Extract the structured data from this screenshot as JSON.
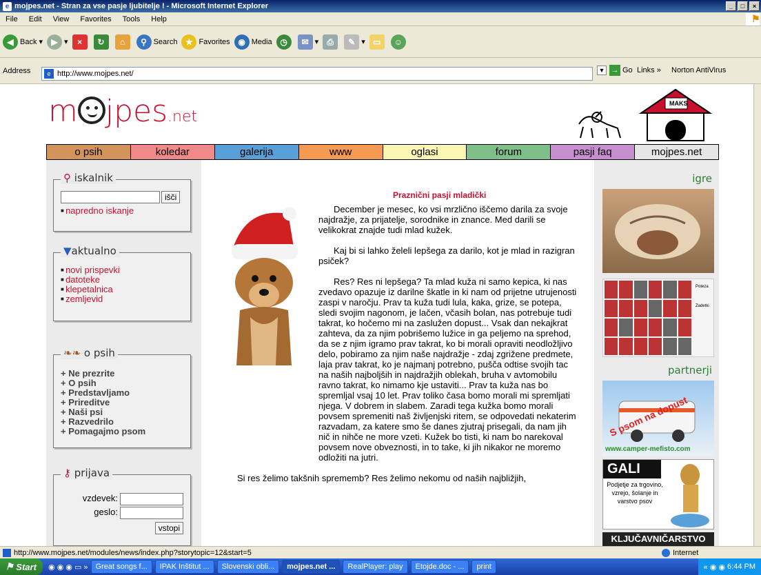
{
  "window": {
    "title": "mojpes.net - Stran za vse pasje ljubitelje ! - Microsoft Internet Explorer"
  },
  "menu": [
    "File",
    "Edit",
    "View",
    "Favorites",
    "Tools",
    "Help"
  ],
  "toolbar": {
    "back": "Back",
    "search": "Search",
    "favorites": "Favorites",
    "media": "Media"
  },
  "address": {
    "label": "Address",
    "url": "http://www.mojpes.net/",
    "go": "Go",
    "links": "Links",
    "antivirus": "Norton AntiVirus"
  },
  "site": {
    "logo_main": "m",
    "logo_rest": "jpes",
    "logo_net": ".net",
    "house_label": "MAKS",
    "nav": [
      {
        "label": "o psih",
        "color": "#d2945a"
      },
      {
        "label": "koledar",
        "color": "#f08a8a"
      },
      {
        "label": "galerija",
        "color": "#5aa0d8"
      },
      {
        "label": "www",
        "color": "#f49a52"
      },
      {
        "label": "oglasi",
        "color": "#fcf6b4"
      },
      {
        "label": "forum",
        "color": "#7fbf8a"
      },
      {
        "label": "pasji faq",
        "color": "#c78ed0"
      },
      {
        "label": "mojpes.net",
        "color": "#e6e6e6"
      }
    ],
    "iskalnik": {
      "title": "iskalnik",
      "button": "išči",
      "link": "napredno iskanje"
    },
    "aktualno": {
      "title": "aktualno",
      "items": [
        "novi prispevki",
        "datoteke",
        "klepetalnica",
        "zemljevid"
      ]
    },
    "opsih": {
      "title": "o psih",
      "items": [
        "Ne prezrite",
        "O psih",
        "Predstavljamo",
        "Prireditve",
        "Naši psi",
        "Razvedrilo",
        "Pomagajmo psom"
      ]
    },
    "prijava": {
      "title": "prijava",
      "user_label": "vzdevek:",
      "pass_label": "geslo:",
      "button": "vstopi"
    },
    "article_title": "Praznični pasji mladički",
    "paragraphs": [
      "December je mesec, ko vsi mrzlično iščemo darila za svoje najdražje, za prijatelje, sorodnike in znance. Med darili se velikokrat znajde tudi mlad kužek.",
      "Kaj bi si lahko želeli lepšega za darilo, kot je mlad in razigran psiček?",
      "Res? Res ni lepšega? Ta mlad kuža ni samo kepica, ki nas zvedavo opazuje iz darilne škatle in ki nam od prijetne utrujenosti zaspi v naročju. Prav ta kuža tudi lula, kaka, grize, se potepa, sledi svojim nagonom, je lačen, včasih bolan, nas potrebuje tudi takrat, ko hočemo mi na zaslužen dopust... Vsak dan nekajkrat zahteva, da za njim pobrišemo lužice in ga peljemo na sprehod, da se z njim igramo prav takrat, ko bi morali opraviti neodložljivo delo, pobiramo za njim naše najdražje - zdaj zgrižene predmete, laja prav takrat, ko je najmanj potrebno, pušča odtise svojih tac na naših najboljših in najdražjih oblekah, bruha v avtomobilu ravno takrat, ko nimamo kje ustaviti... Prav ta kuža nas bo spremljal vsaj 10 let. Prav toliko časa bomo morali mi spremljati njega. V dobrem in slabem. Zaradi tega kužka bomo morali povsem spremeniti naš življenjski ritem, se odpovedati nekaterim razvadam, za katere smo še danes zjutraj prisegali, da nam jih nič in nihče ne more vzeti. Kužek bo tisti, ki nam bo narekoval povsem nove obveznosti, in to take, ki jih nikakor ne moremo odložiti na jutri.",
      "Si res želimo takšnih sprememb? Res želimo nekomu od naših najbližjih,"
    ],
    "right_igre": "igre",
    "right_partnerji": "partnerji",
    "camper_text": "S psom na dopust",
    "camper_url": "www.camper-mefisto.com",
    "gali_title": "GALI",
    "gali_text": "Podjetje za trgovino, vzrejo, šolanje in varstvo psov",
    "kljucavnicarstvo": "KLJUČAVNIČARSTVO",
    "puzzle_label1": "Poteza",
    "puzzle_label2": "Zadetki"
  },
  "status": {
    "url": "http://www.mojpes.net/modules/news/index.php?storytopic=12&start=5",
    "zone": "Internet"
  },
  "taskbar": {
    "start": "Start",
    "items": [
      "Great songs f...",
      "IPAK Inštitut ...",
      "Slovenski obli...",
      "mojpes.net ...",
      "RealPlayer: play",
      "Etojde.doc - ...",
      "print"
    ],
    "time": "6:44 PM"
  }
}
